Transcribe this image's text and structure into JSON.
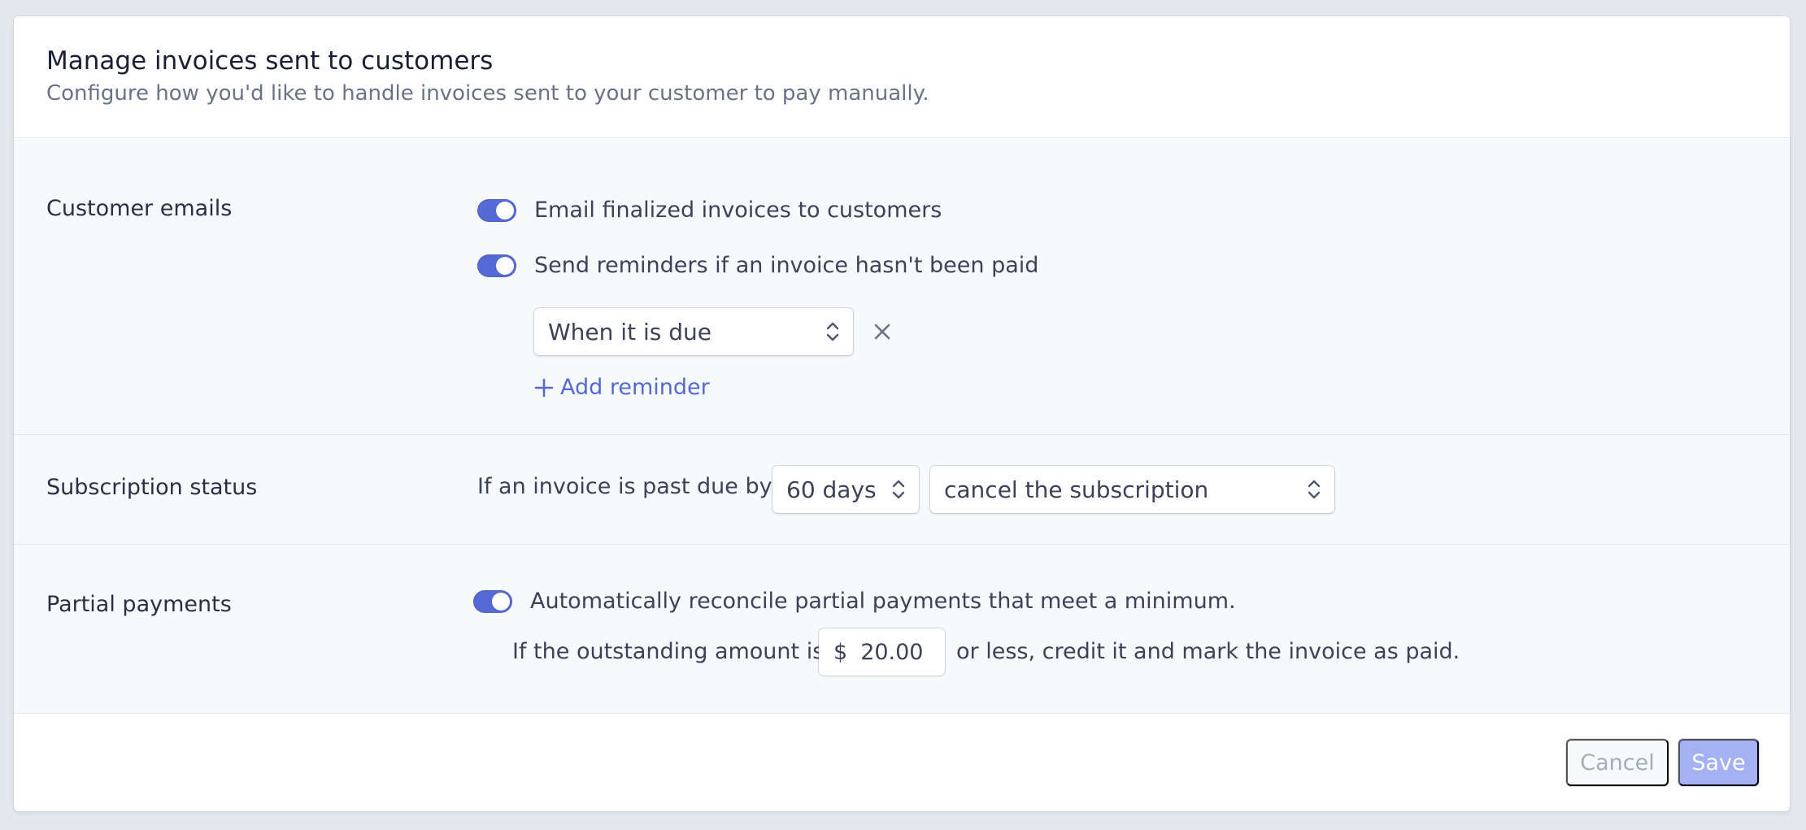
{
  "header": {
    "title": "Manage invoices sent to customers",
    "subtitle": "Configure how you'd like to handle invoices sent to your customer to pay manually."
  },
  "customer_emails": {
    "label": "Customer emails",
    "email_finalized": {
      "label": "Email finalized invoices to customers",
      "enabled": true
    },
    "send_reminders": {
      "label": "Send reminders if an invoice hasn't been paid",
      "enabled": true
    },
    "reminder_select": {
      "value": "When it is due",
      "icon": "chevron-up-down-icon"
    },
    "remove_icon": "close-icon",
    "add_reminder": {
      "label": "Add reminder",
      "icon": "plus-icon"
    }
  },
  "subscription_status": {
    "label": "Subscription status",
    "prefix": "If an invoice is past due by",
    "days_select": "60 days",
    "action_select": "cancel the subscription"
  },
  "partial_payments": {
    "label": "Partial payments",
    "auto_reconcile": {
      "label": "Automatically reconcile partial payments that meet a minimum.",
      "enabled": true
    },
    "prefix": "If the outstanding amount is",
    "currency_symbol": "$",
    "amount": "20.00",
    "suffix": "or less, credit it and mark the invoice as paid."
  },
  "footer": {
    "cancel_label": "Cancel",
    "save_label": "Save"
  },
  "colors": {
    "accent": "#5469d4",
    "save_disabled": "#a4b1f2",
    "section_bg": "#f7fafc",
    "page_bg": "#e3e8ee"
  }
}
